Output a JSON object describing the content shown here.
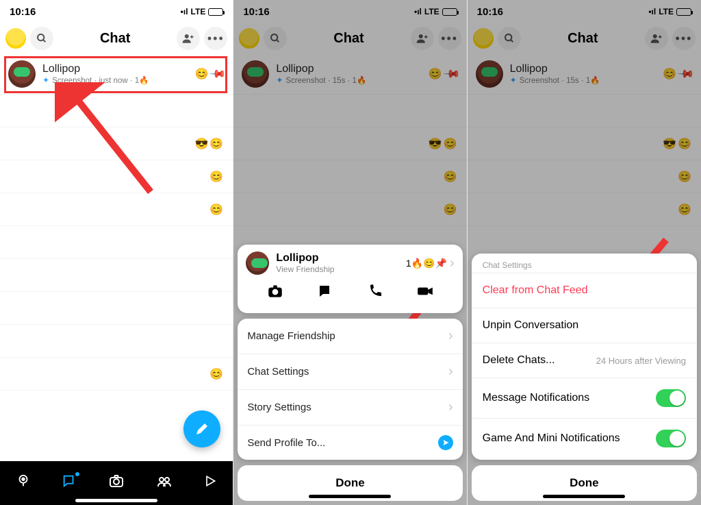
{
  "status": {
    "time": "10:16",
    "network": "LTE"
  },
  "header": {
    "title": "Chat"
  },
  "contact": {
    "name": "Lollipop",
    "status_left": "Screenshot · just now · 1🔥",
    "status_15s": "Screenshot · 15s · 1🔥",
    "view_friendship": "View Friendship",
    "pin_badge": "1🔥😊📌"
  },
  "sheet": {
    "manage": "Manage Friendship",
    "chat_settings": "Chat Settings",
    "story_settings": "Story Settings",
    "send_profile": "Send Profile To...",
    "done": "Done"
  },
  "chat_settings": {
    "title": "Chat Settings",
    "clear": "Clear from Chat Feed",
    "unpin": "Unpin Conversation",
    "delete": "Delete Chats...",
    "delete_sub": "24 Hours after Viewing",
    "notif": "Message Notifications",
    "game_notif": "Game And Mini Notifications"
  }
}
